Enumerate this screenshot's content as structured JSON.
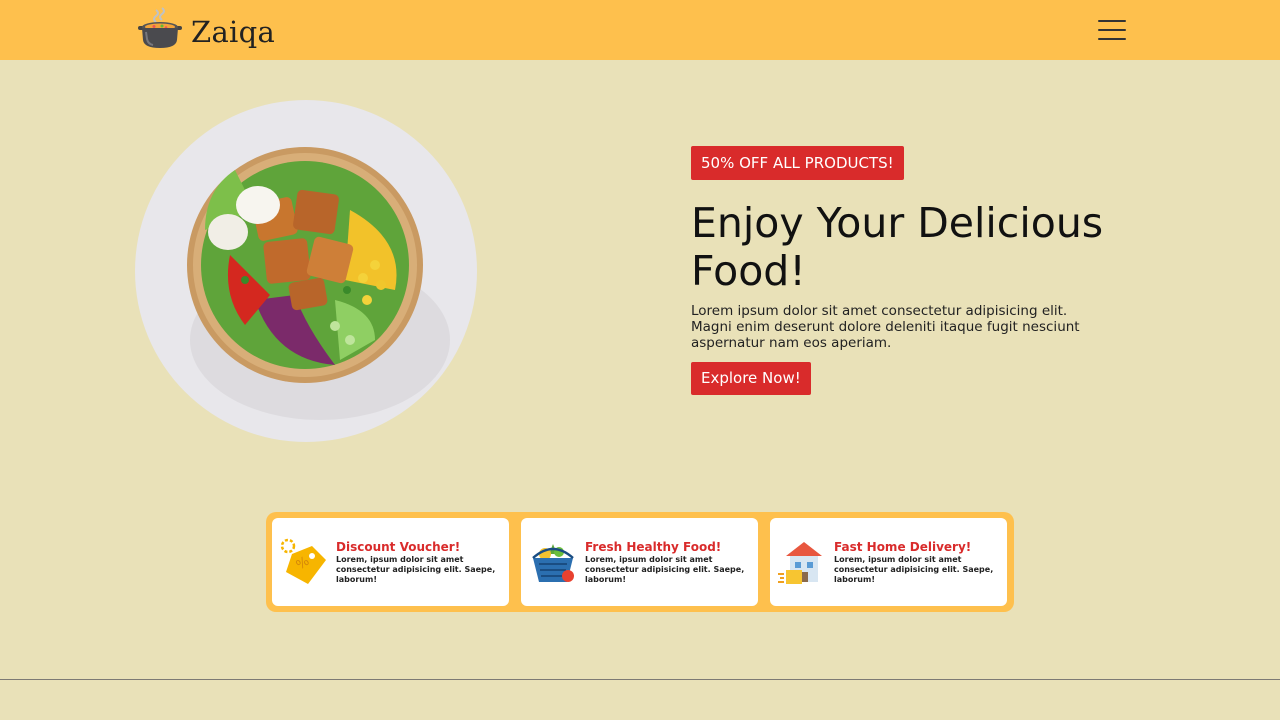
{
  "navbar": {
    "brand_name": "Zaiqa",
    "logo_icon": "cooking-pot-icon",
    "menu_icon": "hamburger-menu-icon",
    "background": "#fec04d"
  },
  "hero": {
    "image_icon": "salad-bowl-image",
    "badge": "50% OFF ALL PRODUCTS!",
    "title": "Enjoy Your Delicious Food!",
    "description": "Lorem ipsum dolor sit amet consectetur adipisicing elit. Magni enim deserunt dolore deleniti itaque fugit nesciunt aspernatur nam eos aperiam.",
    "cta_label": "Explore Now!",
    "accent": "#d92b2b"
  },
  "features": [
    {
      "icon": "discount-tag-icon",
      "title": "Discount Voucher!",
      "body": "Lorem, ipsum dolor sit amet consectetur adipisicing elit. Saepe, laborum!"
    },
    {
      "icon": "grocery-basket-icon",
      "title": "Fresh Healthy Food!",
      "body": "Lorem, ipsum dolor sit amet consectetur adipisicing elit. Saepe, laborum!"
    },
    {
      "icon": "home-delivery-icon",
      "title": "Fast Home Delivery!",
      "body": "Lorem, ipsum dolor sit amet consectetur adipisicing elit. Saepe, laborum!"
    }
  ],
  "colors": {
    "page_background": "#e9e1b8",
    "accent": "#d92b2b",
    "header": "#fec04d"
  }
}
